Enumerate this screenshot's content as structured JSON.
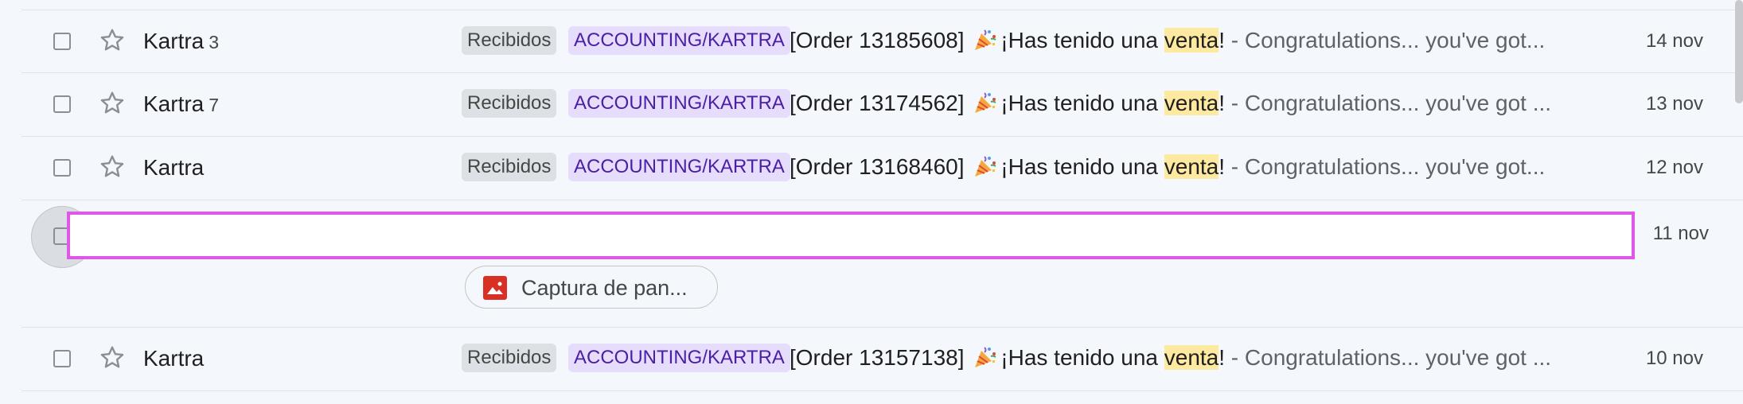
{
  "rows": [
    {
      "sender": "Kartra",
      "count": "3",
      "chip_inbox": "Recibidos",
      "chip_label": "ACCOUNTING/KARTRA",
      "subject_before": "[Order 13185608]",
      "subject_mid": "¡Has tenido una ",
      "subject_highlight": "venta",
      "subject_after": "!",
      "snippet": " - Congratulations... you've got...",
      "date": "14 nov"
    },
    {
      "sender": "Kartra",
      "count": "7",
      "chip_inbox": "Recibidos",
      "chip_label": "ACCOUNTING/KARTRA",
      "subject_before": "[Order 13174562]",
      "subject_mid": "¡Has tenido una ",
      "subject_highlight": "venta",
      "subject_after": "!",
      "snippet": " - Congratulations... you've got ...",
      "date": "13 nov"
    },
    {
      "sender": "Kartra",
      "count": "",
      "chip_inbox": "Recibidos",
      "chip_label": "ACCOUNTING/KARTRA",
      "subject_before": "[Order 13168460]",
      "subject_mid": "¡Has tenido una ",
      "subject_highlight": "venta",
      "subject_after": "!",
      "snippet": " - Congratulations... you've got...",
      "date": "12 nov"
    },
    {
      "date": "11 nov",
      "attachment_label": "Captura de pan...",
      "attachment_icon": "image-icon"
    },
    {
      "sender": "Kartra",
      "count": "",
      "chip_inbox": "Recibidos",
      "chip_label": "ACCOUNTING/KARTRA",
      "subject_before": "[Order 13157138]",
      "subject_mid": "¡Has tenido una ",
      "subject_highlight": "venta",
      "subject_after": "!",
      "snippet": " - Congratulations... you've got ...",
      "date": "10 nov"
    }
  ],
  "icons": {
    "star": "star-outline-icon",
    "party": "party-popper-icon",
    "attachment": "image-icon"
  },
  "colors": {
    "highlight": "#fde9a0",
    "label_chip_bg": "#e6dcfc",
    "label_chip_text": "#4b1ea6",
    "inbox_chip_bg": "#dde0e4",
    "focus_border": "#e056e6",
    "attachment_icon": "#d93025"
  }
}
